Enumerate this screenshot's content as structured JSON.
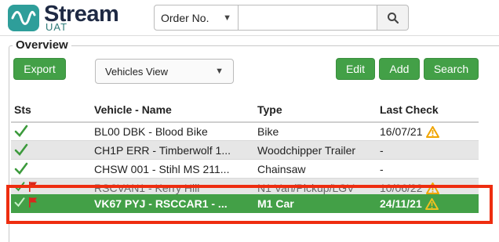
{
  "brand": {
    "name": "Stream",
    "env": "UAT"
  },
  "search": {
    "mode_selected": "Order No.",
    "input_value": ""
  },
  "overview": {
    "title": "Overview",
    "export_label": "Export",
    "view_selected": "Vehicles View",
    "edit_label": "Edit",
    "add_label": "Add",
    "search_label": "Search"
  },
  "table": {
    "columns": [
      "Sts",
      "Vehicle - Name",
      "Type",
      "Last Check"
    ],
    "rows": [
      {
        "vehicle": "BL00 DBK - Blood Bike",
        "type": "Bike",
        "last_check": "16/07/21",
        "warn": true,
        "flag": false
      },
      {
        "vehicle": "CH1P ERR - Timberwolf 1...",
        "type": "Woodchipper Trailer",
        "last_check": "-",
        "warn": false,
        "flag": false
      },
      {
        "vehicle": "CHSW 001 - Stihl MS 211...",
        "type": "Chainsaw",
        "last_check": "-",
        "warn": false,
        "flag": false
      },
      {
        "vehicle": "RSCVAN1 - Kerry Hill",
        "type": "N1 Van/Pickup/LGV",
        "last_check": "10/06/22",
        "warn": true,
        "flag": true
      },
      {
        "vehicle": "VK67 PYJ - RSCCAR1 - ...",
        "type": "M1 Car",
        "last_check": "24/11/21",
        "warn": true,
        "flag": true
      }
    ]
  },
  "colors": {
    "accent_green": "#43a047",
    "highlight_red": "#ee2d10",
    "warn_amber": "#f0a500",
    "flag_red": "#d9271c"
  }
}
